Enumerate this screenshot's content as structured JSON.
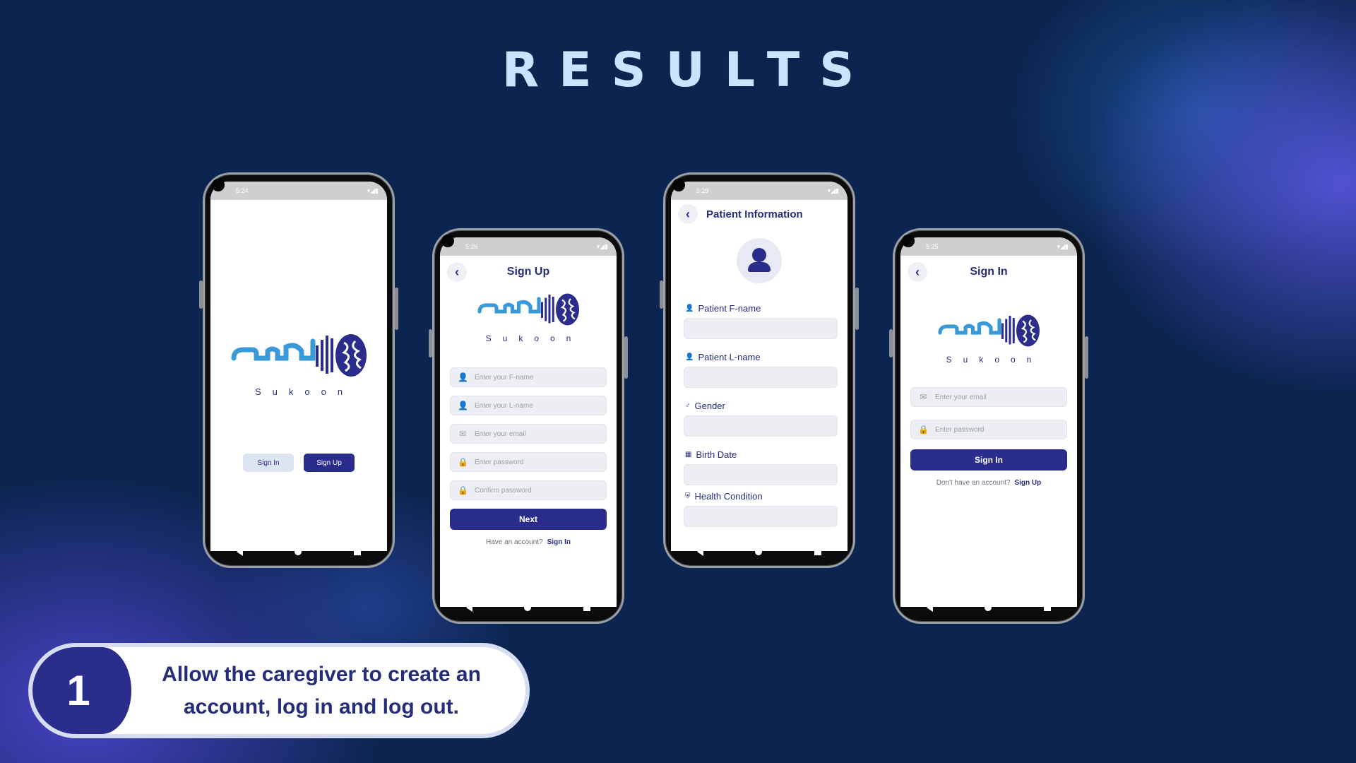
{
  "page": {
    "title": "RESULTS"
  },
  "phones": {
    "splash": {
      "time": "5:24",
      "brand": "Sukoon",
      "signin": "Sign In",
      "signup": "Sign Up"
    },
    "signup": {
      "time": "5:26",
      "title": "Sign Up",
      "brand": "Sukoon",
      "fields": [
        "Enter your F-name",
        "Enter your L-name",
        "Enter your email",
        "Enter password",
        "Confirm password"
      ],
      "next": "Next",
      "foot_text": "Have an account?",
      "foot_link": "Sign In"
    },
    "patient": {
      "time": "5:29",
      "title": "Patient Information",
      "labels": [
        "Patient F-name",
        "Patient L-name",
        "Gender",
        "Birth Date",
        "Health Condition"
      ]
    },
    "signin": {
      "time": "5:25",
      "title": "Sign In",
      "brand": "Sukoon",
      "fields": [
        "Enter your email",
        "Enter password"
      ],
      "button": "Sign In",
      "foot_text": "Don't have an account?",
      "foot_link": "Sign Up"
    }
  },
  "banner": {
    "number": "1",
    "text": "Allow the caregiver to create an account, log in and log out."
  },
  "colors": {
    "navy": "#2a2d8c",
    "accent_blue": "#3a9ad9",
    "title": "#c9e4ff"
  }
}
